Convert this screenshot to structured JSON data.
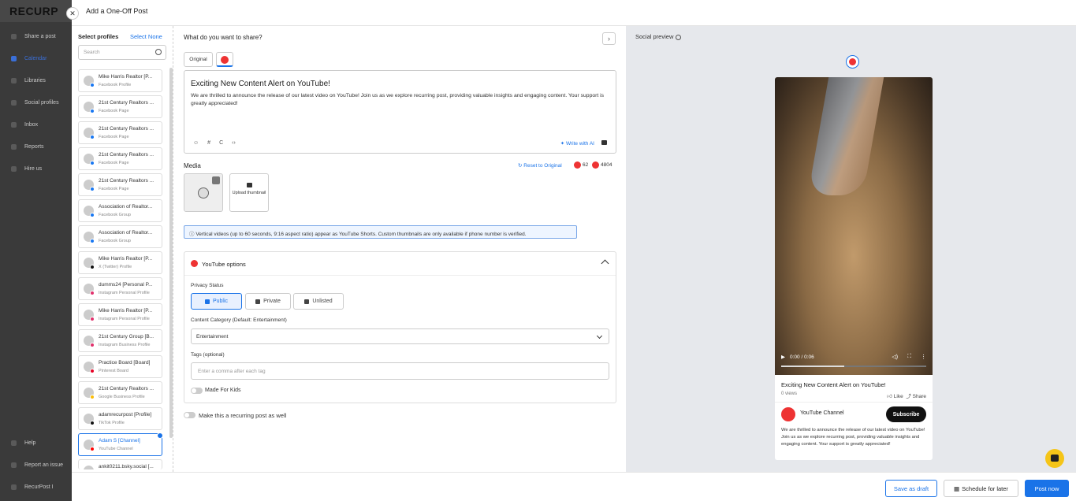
{
  "bg_app": {
    "logo": "RECURP",
    "nav": [
      {
        "label": "Share a post",
        "icon": "send-icon",
        "active": false
      },
      {
        "label": "Calendar",
        "icon": "calendar-icon",
        "active": true
      },
      {
        "label": "Libraries",
        "icon": "library-icon",
        "active": false
      },
      {
        "label": "Social profiles",
        "icon": "profile-icon",
        "active": false
      },
      {
        "label": "Inbox",
        "icon": "inbox-icon",
        "active": false
      },
      {
        "label": "Reports",
        "icon": "report-icon",
        "active": false
      },
      {
        "label": "Hire us",
        "icon": "user-icon",
        "active": false
      }
    ],
    "bottom_nav": [
      {
        "label": "Help"
      },
      {
        "label": "Report an issue"
      },
      {
        "label": "RecurPost I"
      }
    ]
  },
  "modal": {
    "title": "Add a One-Off Post",
    "close_icon": "close-icon"
  },
  "profiles": {
    "heading": "Select profiles",
    "select_none": "Select None",
    "search_placeholder": "Search",
    "items": [
      {
        "name": "Mike Harris Realtor [P...",
        "type": "Facebook Profile",
        "badge": "#1877f2"
      },
      {
        "name": "21st Century Realtors ...",
        "type": "Facebook Page",
        "badge": "#1877f2"
      },
      {
        "name": "21st Century Realtors ...",
        "type": "Facebook Page",
        "badge": "#1877f2"
      },
      {
        "name": "21st Century Realtors ...",
        "type": "Facebook Page",
        "badge": "#1877f2"
      },
      {
        "name": "21st Century Realtors ...",
        "type": "Facebook Page",
        "badge": "#1877f2"
      },
      {
        "name": "Association of Realtor...",
        "type": "Facebook Group",
        "badge": "#1877f2"
      },
      {
        "name": "Association of Realtor...",
        "type": "Facebook Group",
        "badge": "#1877f2"
      },
      {
        "name": "Mike Harris Realtor [P...",
        "type": "X (Twitter) Profile",
        "badge": "#111111"
      },
      {
        "name": "dumms24 [Personal P...",
        "type": "Instagram Personal Profile",
        "badge": "#e1306c"
      },
      {
        "name": "Mike Harris Realtor [P...",
        "type": "Instagram Personal Profile",
        "badge": "#e1306c"
      },
      {
        "name": "21st Century Group [B...",
        "type": "Instagram Business Profile",
        "badge": "#e1306c"
      },
      {
        "name": "Practice Board [Board]",
        "type": "Pinterest Board",
        "badge": "#e60023"
      },
      {
        "name": "21st Century Realtors ...",
        "type": "Google Business Profile",
        "badge": "#fbbc05"
      },
      {
        "name": "adamrecurpost [Profile]",
        "type": "TikTok Profile",
        "badge": "#111111"
      },
      {
        "name": "Adam S [Channel]",
        "type": "YouTube Channel",
        "badge": "#ff0000",
        "selected": true
      },
      {
        "name": "ankit0211.bsky.social [...",
        "type": "",
        "badge": "#1185fe"
      }
    ]
  },
  "compose": {
    "question": "What do you want to share?",
    "tab_original": "Original",
    "post_title": "Exciting New Content Alert on YouTube!",
    "post_body": "We are thrilled to announce the release of our latest video on YouTube! Join us as we explore recurring post, providing valuable insights and engaging content. Your support is greatly appreciated!",
    "tools": [
      "☺",
      "#",
      "C",
      "‹›"
    ],
    "write_ai": "Write with AI",
    "media_label": "Media",
    "reset": "Reset to Original",
    "count_title": "62",
    "count_body": "4804",
    "upload_thumb": "Upload thumbnail",
    "note": "Vertical videos (up to 60 seconds, 9:16 aspect ratio) appear as YouTube Shorts. Custom thumbnails are only available if phone number is verified.",
    "yt_options": "YouTube options",
    "privacy_label": "Privacy Status",
    "privacy": [
      {
        "label": "Public",
        "on": true
      },
      {
        "label": "Private",
        "on": false
      },
      {
        "label": "Unlisted",
        "on": false
      }
    ],
    "category_label": "Content Category (Default: Entertainment)",
    "category_value": "Entertainment",
    "tags_label": "Tags (optional)",
    "tags_placeholder": "Enter a comma after each tag",
    "made_for_kids": "Made For Kids",
    "recurring": "Make this a recurring post as well"
  },
  "preview": {
    "title": "Social preview",
    "time": "0:00 / 0:06",
    "video_title": "Exciting New Content Alert on YouTube!",
    "views": "0 views",
    "like": "Like",
    "share": "Share",
    "channel": "YouTube Channel",
    "subscribe": "Subscribe",
    "desc": "We are thrilled to announce the release of our latest video on YouTube! Join us as we explore recurring post, providing valuable insights and engaging content. Your support is greatly appreciated!"
  },
  "footer": {
    "draft": "Save as draft",
    "later": "Schedule for later",
    "now": "Post now"
  }
}
